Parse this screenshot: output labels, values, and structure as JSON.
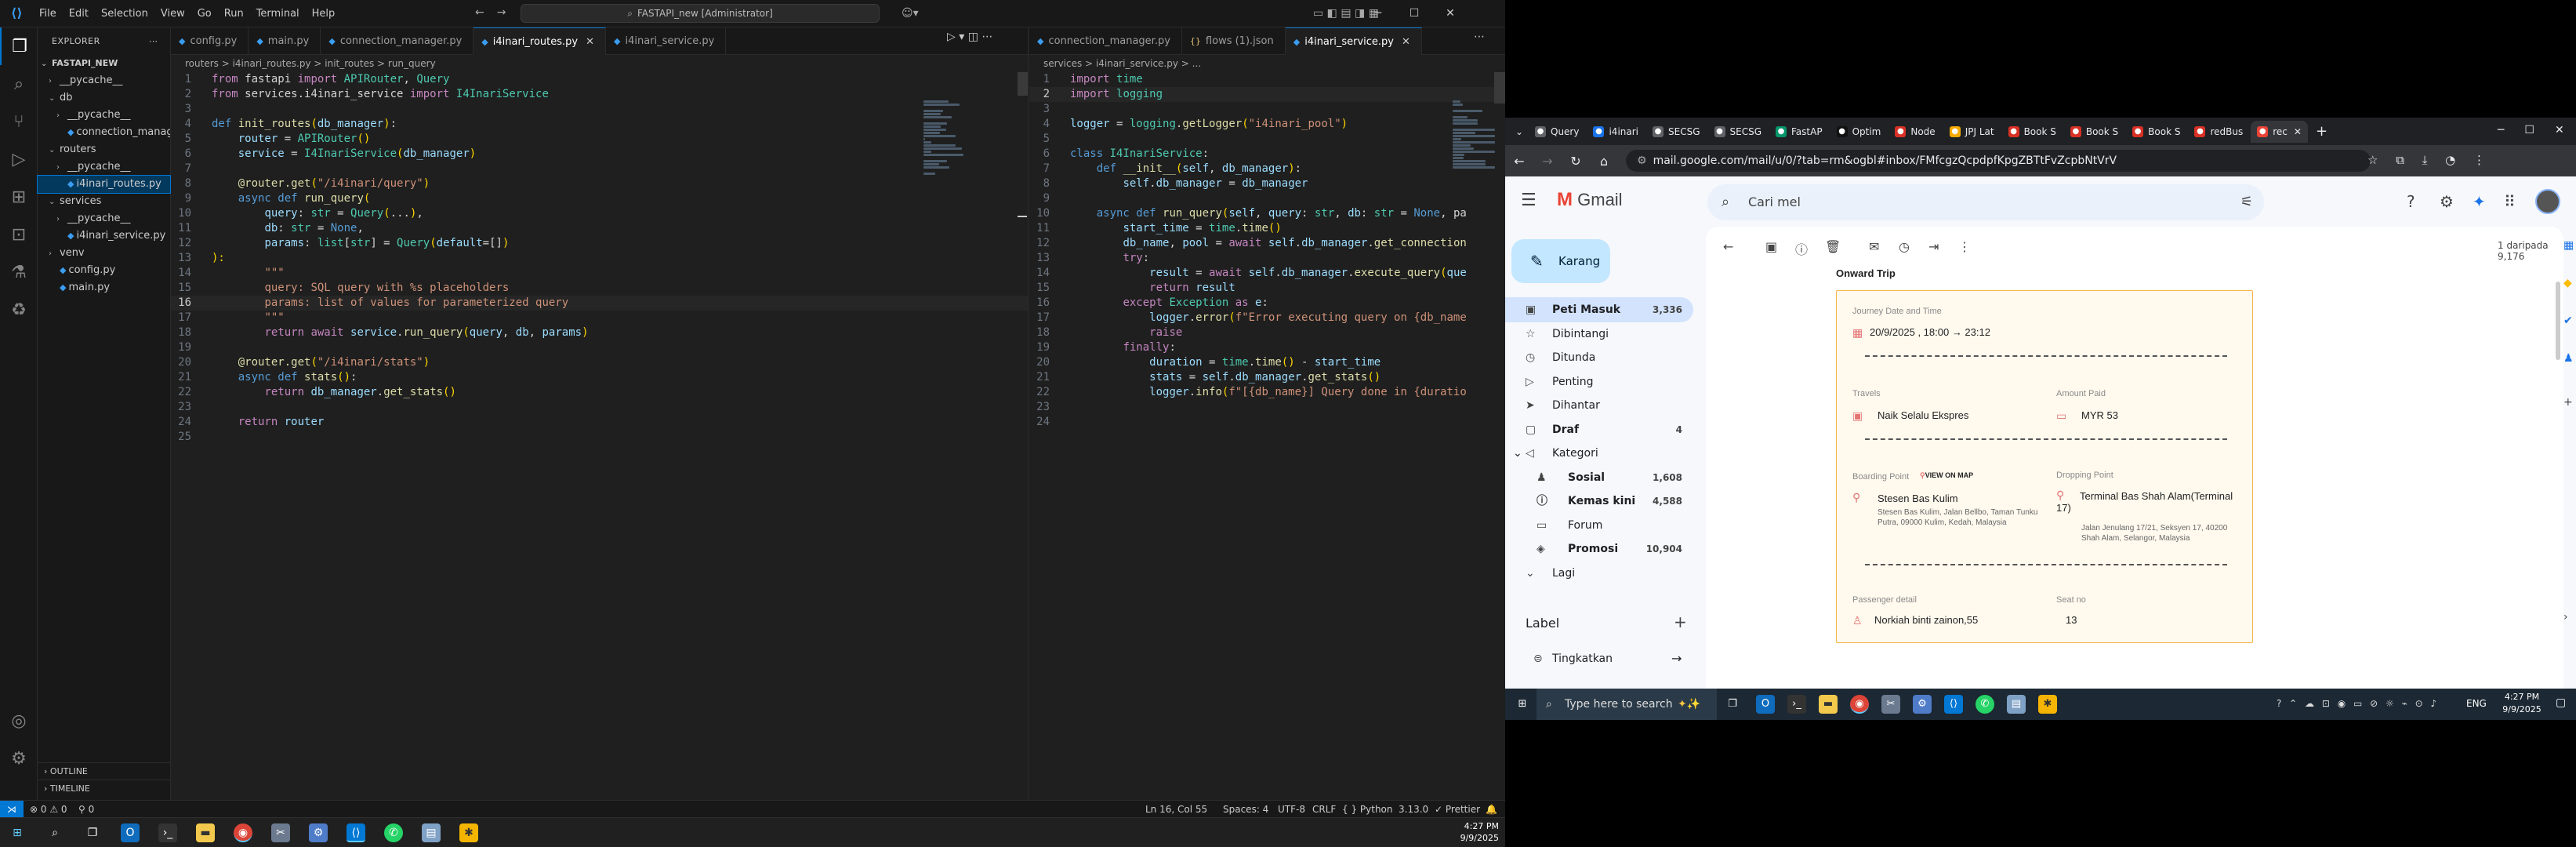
{
  "vscode": {
    "menu": [
      "File",
      "Edit",
      "Selection",
      "View",
      "Go",
      "Run",
      "Terminal",
      "Help"
    ],
    "command_center": "FASTAPI_new [Administrator]",
    "explorer_title": "EXPLORER",
    "project": "FASTAPI_NEW",
    "tree": [
      {
        "label": "__pycache__",
        "indent": 1,
        "type": "folder",
        "open": false
      },
      {
        "label": "db",
        "indent": 1,
        "type": "folder",
        "open": true
      },
      {
        "label": "__pycache__",
        "indent": 2,
        "type": "folder",
        "open": false
      },
      {
        "label": "connection_manage...",
        "indent": 2,
        "type": "py"
      },
      {
        "label": "routers",
        "indent": 1,
        "type": "folder",
        "open": true
      },
      {
        "label": "__pycache__",
        "indent": 2,
        "type": "folder",
        "open": false
      },
      {
        "label": "i4inari_routes.py",
        "indent": 2,
        "type": "py",
        "selected": true
      },
      {
        "label": "services",
        "indent": 1,
        "type": "folder",
        "open": true
      },
      {
        "label": "__pycache__",
        "indent": 2,
        "type": "folder",
        "open": false
      },
      {
        "label": "i4inari_service.py",
        "indent": 2,
        "type": "py"
      },
      {
        "label": "venv",
        "indent": 1,
        "type": "folder",
        "open": false
      },
      {
        "label": "config.py",
        "indent": 1,
        "type": "py"
      },
      {
        "label": "main.py",
        "indent": 1,
        "type": "py"
      }
    ],
    "outline": "OUTLINE",
    "timeline": "TIMELINE",
    "left_tabs": [
      {
        "label": "config.py",
        "active": false
      },
      {
        "label": "main.py",
        "active": false
      },
      {
        "label": "connection_manager.py",
        "active": false
      },
      {
        "label": "i4inari_routes.py",
        "active": true
      },
      {
        "label": "i4inari_service.py",
        "active": false
      }
    ],
    "left_breadcrumb": "routers  >  i4inari_routes.py  >  init_routes  >  run_query",
    "right_tabs": [
      {
        "label": "connection_manager.py",
        "active": false,
        "kind": "py"
      },
      {
        "label": "flows (1).json",
        "active": false,
        "kind": "json"
      },
      {
        "label": "i4inari_service.py",
        "active": true,
        "kind": "py"
      }
    ],
    "right_breadcrumb": "services  >  i4inari_service.py  >  ...",
    "status": {
      "problems": "⊗ 0  ⚠ 0",
      "ws": "0",
      "position": "Ln 16, Col 55",
      "spaces": "Spaces: 4",
      "encoding": "UTF-8",
      "eol": "CRLF",
      "language": "{ } Python",
      "version": "3.13.0",
      "formatter": "✓ Prettier"
    },
    "clock_time": "4:27 PM",
    "clock_date": "9/9/2025"
  },
  "chrome": {
    "tabs": [
      {
        "label": "Query",
        "color": "#5f6368"
      },
      {
        "label": "i4inari",
        "color": "#1a73e8"
      },
      {
        "label": "SECSG",
        "color": "#5f6368"
      },
      {
        "label": "SECSG",
        "color": "#5f6368"
      },
      {
        "label": "FastAP",
        "color": "#059669"
      },
      {
        "label": "Optim",
        "color": "#111111"
      },
      {
        "label": "Node",
        "color": "#d93025"
      },
      {
        "label": "JPJ Lat",
        "color": "#f9ab00"
      },
      {
        "label": "Book S",
        "color": "#d93025"
      },
      {
        "label": "Book S",
        "color": "#d93025"
      },
      {
        "label": "Book S",
        "color": "#d93025"
      },
      {
        "label": "redBus",
        "color": "#d93025"
      },
      {
        "label": "rec",
        "color": "#ea4335",
        "active": true
      }
    ],
    "url": "mail.google.com/mail/u/0/?tab=rm&ogbl#inbox/FMfcgzQcpdpfKpgZBTtFvZcpbNtVrV"
  },
  "gmail": {
    "logo": "Gmail",
    "search_placeholder": "Cari mel",
    "compose": "Karang",
    "nav": [
      {
        "label": "Peti Masuk",
        "count": "3,336",
        "icon": "inbox",
        "active": true
      },
      {
        "label": "Dibintangi",
        "count": "",
        "icon": "star"
      },
      {
        "label": "Ditunda",
        "count": "",
        "icon": "clock"
      },
      {
        "label": "Penting",
        "count": "",
        "icon": "important"
      },
      {
        "label": "Dihantar",
        "count": "",
        "icon": "send"
      },
      {
        "label": "Draf",
        "count": "4",
        "icon": "draft",
        "bold": true
      },
      {
        "label": "Kategori",
        "count": "",
        "icon": "label"
      },
      {
        "label": "Sosial",
        "count": "1,608",
        "icon": "people",
        "bold": true,
        "sub": true
      },
      {
        "label": "Kemas kini",
        "count": "4,588",
        "icon": "info",
        "bold": true,
        "sub": true
      },
      {
        "label": "Forum",
        "count": "",
        "icon": "forum",
        "sub": true
      },
      {
        "label": "Promosi",
        "count": "10,904",
        "icon": "tag",
        "bold": true,
        "sub": true
      },
      {
        "label": "Lagi",
        "count": "",
        "icon": "more"
      }
    ],
    "labels_heading": "Label",
    "upgrade": "Tingkatkan",
    "pager": "1 daripada 9,176",
    "ticket": {
      "section": "Onward Trip",
      "journey_label": "Journey Date and Time",
      "journey_value": "20/9/2025 , 18:00 → 23:12",
      "travels_label": "Travels",
      "travels_value": "Naik Selalu Ekspres",
      "amount_label": "Amount Paid",
      "amount_value": "MYR 53",
      "boarding_label": "Boarding Point",
      "view_map": "VIEW ON MAP",
      "boarding_value": "Stesen Bas Kulim",
      "boarding_addr": "Stesen Bas Kulim, Jalan Bellbo, Taman Tunku Putra, 09000 Kulim, Kedah, Malaysia",
      "dropping_label": "Dropping Point",
      "dropping_value": "Terminal Bas Shah Alam(Terminal 17)",
      "dropping_addr": "Jalan Jenulang 17/21, Seksyen 17, 40200 Shah Alam, Selangor, Malaysia",
      "passenger_label": "Passenger detail",
      "passenger_value": "Norkiah binti zainon,55",
      "seat_label": "Seat no",
      "seat_value": "13"
    }
  },
  "win_taskbar": {
    "search": "Type here to search",
    "lang": "ENG",
    "time": "4:27 PM",
    "date": "9/9/2025"
  },
  "code_left": [
    [
      [
        "kw",
        "from "
      ],
      [
        "op",
        "fastapi "
      ],
      [
        "kw",
        "import "
      ],
      [
        "cls",
        "APIRouter"
      ],
      [
        "op",
        ", "
      ],
      [
        "cls",
        "Query"
      ]
    ],
    [
      [
        "kw",
        "from "
      ],
      [
        "op",
        "services.i4inari_service "
      ],
      [
        "kw",
        "import "
      ],
      [
        "cls",
        "I4InariService"
      ]
    ],
    [],
    [
      [
        "blue",
        "def "
      ],
      [
        "fn",
        "init_routes"
      ],
      [
        "par",
        "("
      ],
      [
        "var",
        "db_manager"
      ],
      [
        "par",
        ")"
      ],
      [
        "op",
        ":"
      ]
    ],
    [
      [
        "op",
        "    "
      ],
      [
        "var",
        "router"
      ],
      [
        "op",
        " = "
      ],
      [
        "cls",
        "APIRouter"
      ],
      [
        "par",
        "()"
      ]
    ],
    [
      [
        "op",
        "    "
      ],
      [
        "var",
        "service"
      ],
      [
        "op",
        " = "
      ],
      [
        "cls",
        "I4InariService"
      ],
      [
        "par",
        "("
      ],
      [
        "var",
        "db_manager"
      ],
      [
        "par",
        ")"
      ]
    ],
    [],
    [
      [
        "op",
        "    "
      ],
      [
        "fn",
        "@router.get"
      ],
      [
        "par",
        "("
      ],
      [
        "str",
        "\"/i4inari/query\""
      ],
      [
        "par",
        ")"
      ]
    ],
    [
      [
        "op",
        "    "
      ],
      [
        "blue",
        "async def "
      ],
      [
        "fn",
        "run_query"
      ],
      [
        "par",
        "("
      ]
    ],
    [
      [
        "op",
        "        "
      ],
      [
        "var",
        "query"
      ],
      [
        "op",
        ": "
      ],
      [
        "cls",
        "str"
      ],
      [
        "op",
        " = "
      ],
      [
        "cls",
        "Query"
      ],
      [
        "par",
        "("
      ],
      [
        "op",
        "..."
      ],
      [
        "par",
        ")"
      ],
      [
        "op",
        ","
      ]
    ],
    [
      [
        "op",
        "        "
      ],
      [
        "var",
        "db"
      ],
      [
        "op",
        ": "
      ],
      [
        "cls",
        "str"
      ],
      [
        "op",
        " = "
      ],
      [
        "blue",
        "None"
      ],
      [
        "op",
        ","
      ]
    ],
    [
      [
        "op",
        "        "
      ],
      [
        "var",
        "params"
      ],
      [
        "op",
        ": "
      ],
      [
        "cls",
        "list"
      ],
      [
        "op",
        "["
      ],
      [
        "cls",
        "str"
      ],
      [
        "op",
        "] = "
      ],
      [
        "cls",
        "Query"
      ],
      [
        "par",
        "("
      ],
      [
        "var",
        "default"
      ],
      [
        "op",
        "=[]"
      ],
      [
        "par",
        ")"
      ]
    ],
    [
      [
        "par",
        "):"
      ]
    ],
    [
      [
        "op",
        "        "
      ],
      [
        "str",
        "\"\"\""
      ]
    ],
    [
      [
        "op",
        "        "
      ],
      [
        "str",
        "query: SQL query with %s placeholders"
      ]
    ],
    [
      [
        "op",
        "        "
      ],
      [
        "str",
        "params: list of values for parameterized query"
      ]
    ],
    [
      [
        "op",
        "        "
      ],
      [
        "str",
        "\"\"\""
      ]
    ],
    [
      [
        "op",
        "        "
      ],
      [
        "kw",
        "return await "
      ],
      [
        "var",
        "service"
      ],
      [
        "op",
        "."
      ],
      [
        "fn",
        "run_query"
      ],
      [
        "par",
        "("
      ],
      [
        "var",
        "query"
      ],
      [
        "op",
        ", "
      ],
      [
        "var",
        "db"
      ],
      [
        "op",
        ", "
      ],
      [
        "var",
        "params"
      ],
      [
        "par",
        ")"
      ]
    ],
    [],
    [
      [
        "op",
        "    "
      ],
      [
        "fn",
        "@router.get"
      ],
      [
        "par",
        "("
      ],
      [
        "str",
        "\"/i4inari/stats\""
      ],
      [
        "par",
        ")"
      ]
    ],
    [
      [
        "op",
        "    "
      ],
      [
        "blue",
        "async def "
      ],
      [
        "fn",
        "stats"
      ],
      [
        "par",
        "()"
      ],
      [
        "op",
        ":"
      ]
    ],
    [
      [
        "op",
        "        "
      ],
      [
        "kw",
        "return "
      ],
      [
        "var",
        "db_manager"
      ],
      [
        "op",
        "."
      ],
      [
        "fn",
        "get_stats"
      ],
      [
        "par",
        "()"
      ]
    ],
    [],
    [
      [
        "op",
        "    "
      ],
      [
        "kw",
        "return "
      ],
      [
        "var",
        "router"
      ]
    ],
    []
  ],
  "code_right": [
    [
      [
        "kw",
        "import "
      ],
      [
        "cls",
        "time"
      ]
    ],
    [
      [
        "kw",
        "import "
      ],
      [
        "cls",
        "logging"
      ]
    ],
    [],
    [
      [
        "var",
        "logger"
      ],
      [
        "op",
        " = "
      ],
      [
        "cls",
        "logging"
      ],
      [
        "op",
        "."
      ],
      [
        "fn",
        "getLogger"
      ],
      [
        "par",
        "("
      ],
      [
        "str",
        "\"i4inari_pool\""
      ],
      [
        "par",
        ")"
      ]
    ],
    [],
    [
      [
        "blue",
        "class "
      ],
      [
        "cls",
        "I4InariService"
      ],
      [
        "op",
        ":"
      ]
    ],
    [
      [
        "op",
        "    "
      ],
      [
        "blue",
        "def "
      ],
      [
        "fn",
        "__init__"
      ],
      [
        "par",
        "("
      ],
      [
        "var",
        "self"
      ],
      [
        "op",
        ", "
      ],
      [
        "var",
        "db_manager"
      ],
      [
        "par",
        ")"
      ],
      [
        "op",
        ":"
      ]
    ],
    [
      [
        "op",
        "        "
      ],
      [
        "var",
        "self"
      ],
      [
        "op",
        "."
      ],
      [
        "var",
        "db_manager"
      ],
      [
        "op",
        " = "
      ],
      [
        "var",
        "db_manager"
      ]
    ],
    [],
    [
      [
        "op",
        "    "
      ],
      [
        "blue",
        "async def "
      ],
      [
        "fn",
        "run_query"
      ],
      [
        "par",
        "("
      ],
      [
        "var",
        "self"
      ],
      [
        "op",
        ", "
      ],
      [
        "var",
        "query"
      ],
      [
        "op",
        ": "
      ],
      [
        "cls",
        "str"
      ],
      [
        "op",
        ", "
      ],
      [
        "var",
        "db"
      ],
      [
        "op",
        ": "
      ],
      [
        "cls",
        "str"
      ],
      [
        "op",
        " = "
      ],
      [
        "blue",
        "None"
      ],
      [
        "op",
        ", pa"
      ]
    ],
    [
      [
        "op",
        "        "
      ],
      [
        "var",
        "start_time"
      ],
      [
        "op",
        " = "
      ],
      [
        "cls",
        "time"
      ],
      [
        "op",
        "."
      ],
      [
        "fn",
        "time"
      ],
      [
        "par",
        "()"
      ]
    ],
    [
      [
        "op",
        "        "
      ],
      [
        "var",
        "db_name"
      ],
      [
        "op",
        ", "
      ],
      [
        "var",
        "pool"
      ],
      [
        "op",
        " = "
      ],
      [
        "kw",
        "await "
      ],
      [
        "var",
        "self"
      ],
      [
        "op",
        "."
      ],
      [
        "var",
        "db_manager"
      ],
      [
        "op",
        "."
      ],
      [
        "fn",
        "get_connection"
      ]
    ],
    [
      [
        "op",
        "        "
      ],
      [
        "kw",
        "try"
      ],
      [
        "op",
        ":"
      ]
    ],
    [
      [
        "op",
        "            "
      ],
      [
        "var",
        "result"
      ],
      [
        "op",
        " = "
      ],
      [
        "kw",
        "await "
      ],
      [
        "var",
        "self"
      ],
      [
        "op",
        "."
      ],
      [
        "var",
        "db_manager"
      ],
      [
        "op",
        "."
      ],
      [
        "fn",
        "execute_query"
      ],
      [
        "par",
        "("
      ],
      [
        "var",
        "que"
      ]
    ],
    [
      [
        "op",
        "            "
      ],
      [
        "kw",
        "return "
      ],
      [
        "var",
        "result"
      ]
    ],
    [
      [
        "op",
        "        "
      ],
      [
        "kw",
        "except "
      ],
      [
        "cls",
        "Exception"
      ],
      [
        "kw",
        " as "
      ],
      [
        "var",
        "e"
      ],
      [
        "op",
        ":"
      ]
    ],
    [
      [
        "op",
        "            "
      ],
      [
        "var",
        "logger"
      ],
      [
        "op",
        "."
      ],
      [
        "fn",
        "error"
      ],
      [
        "par",
        "("
      ],
      [
        "str",
        "f\"Error executing query on {db_name"
      ]
    ],
    [
      [
        "op",
        "            "
      ],
      [
        "kw",
        "raise"
      ]
    ],
    [
      [
        "op",
        "        "
      ],
      [
        "kw",
        "finally"
      ],
      [
        "op",
        ":"
      ]
    ],
    [
      [
        "op",
        "            "
      ],
      [
        "var",
        "duration"
      ],
      [
        "op",
        " = "
      ],
      [
        "cls",
        "time"
      ],
      [
        "op",
        "."
      ],
      [
        "fn",
        "time"
      ],
      [
        "par",
        "()"
      ],
      [
        "op",
        " - "
      ],
      [
        "var",
        "start_time"
      ]
    ],
    [
      [
        "op",
        "            "
      ],
      [
        "var",
        "stats"
      ],
      [
        "op",
        " = "
      ],
      [
        "var",
        "self"
      ],
      [
        "op",
        "."
      ],
      [
        "var",
        "db_manager"
      ],
      [
        "op",
        "."
      ],
      [
        "fn",
        "get_stats"
      ],
      [
        "par",
        "()"
      ]
    ],
    [
      [
        "op",
        "            "
      ],
      [
        "var",
        "logger"
      ],
      [
        "op",
        "."
      ],
      [
        "fn",
        "info"
      ],
      [
        "par",
        "("
      ],
      [
        "str",
        "f\"[{db_name}] Query done in {duratio"
      ]
    ],
    [],
    []
  ]
}
